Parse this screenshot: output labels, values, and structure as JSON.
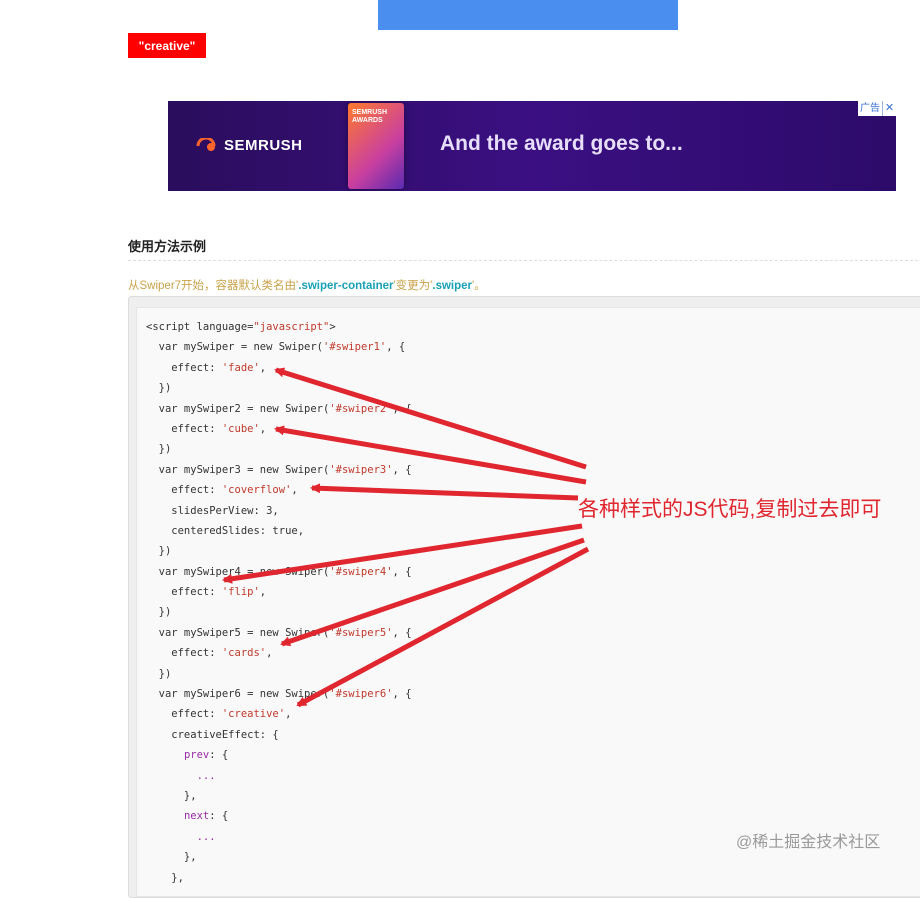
{
  "tag": {
    "label": "\"creative\""
  },
  "ad": {
    "brand": "SEMRUSH",
    "trophy_text": "SEMRUSH AWARDS",
    "headline": "And the award goes to...",
    "badge": "广告",
    "close": "✕"
  },
  "section": {
    "title": "使用方法示例"
  },
  "note": {
    "prefix": "从Swiper7开始，容器默认类名由'",
    "old_class": ".swiper-container",
    "middle": "'变更为'",
    "new_class": ".swiper",
    "suffix": "'。"
  },
  "code_lines": [
    [
      {
        "t": "<script language=",
        "c": ""
      },
      {
        "t": "\"javascript\"",
        "c": "s"
      },
      {
        "t": ">",
        "c": ""
      }
    ],
    [
      {
        "t": "  var mySwiper = new Swiper(",
        "c": ""
      },
      {
        "t": "'#swiper1'",
        "c": "s"
      },
      {
        "t": ", {",
        "c": ""
      }
    ],
    [
      {
        "t": "    effect: ",
        "c": ""
      },
      {
        "t": "'fade'",
        "c": "s"
      },
      {
        "t": ",",
        "c": ""
      }
    ],
    [
      {
        "t": "  })",
        "c": ""
      }
    ],
    [
      {
        "t": "  var mySwiper2 = new Swiper(",
        "c": ""
      },
      {
        "t": "'#swiper2'",
        "c": "s"
      },
      {
        "t": ", {",
        "c": ""
      }
    ],
    [
      {
        "t": "    effect: ",
        "c": ""
      },
      {
        "t": "'cube'",
        "c": "s"
      },
      {
        "t": ",",
        "c": ""
      }
    ],
    [
      {
        "t": "  })",
        "c": ""
      }
    ],
    [
      {
        "t": "  var mySwiper3 = new Swiper(",
        "c": ""
      },
      {
        "t": "'#swiper3'",
        "c": "s"
      },
      {
        "t": ", {",
        "c": ""
      }
    ],
    [
      {
        "t": "    effect: ",
        "c": ""
      },
      {
        "t": "'coverflow'",
        "c": "s"
      },
      {
        "t": ",",
        "c": ""
      }
    ],
    [
      {
        "t": "    slidesPerView: 3,",
        "c": ""
      }
    ],
    [
      {
        "t": "    centeredSlides: true,",
        "c": ""
      }
    ],
    [
      {
        "t": "  })",
        "c": ""
      }
    ],
    [
      {
        "t": "  var mySwiper4 = new Swiper(",
        "c": ""
      },
      {
        "t": "'#swiper4'",
        "c": "s"
      },
      {
        "t": ", {",
        "c": ""
      }
    ],
    [
      {
        "t": "    effect: ",
        "c": ""
      },
      {
        "t": "'flip'",
        "c": "s"
      },
      {
        "t": ",",
        "c": ""
      }
    ],
    [
      {
        "t": "  })",
        "c": ""
      }
    ],
    [
      {
        "t": "  var mySwiper5 = new Swiper(",
        "c": ""
      },
      {
        "t": "'#swiper5'",
        "c": "s"
      },
      {
        "t": ", {",
        "c": ""
      }
    ],
    [
      {
        "t": "    effect: ",
        "c": ""
      },
      {
        "t": "'cards'",
        "c": "s"
      },
      {
        "t": ",",
        "c": ""
      }
    ],
    [
      {
        "t": "  })",
        "c": ""
      }
    ],
    [
      {
        "t": "  var mySwiper6 = new Swiper(",
        "c": ""
      },
      {
        "t": "'#swiper6'",
        "c": "s"
      },
      {
        "t": ", {",
        "c": ""
      }
    ],
    [
      {
        "t": "    effect: ",
        "c": ""
      },
      {
        "t": "'creative'",
        "c": "s"
      },
      {
        "t": ",",
        "c": ""
      }
    ],
    [
      {
        "t": "    creativeEffect: {",
        "c": ""
      }
    ],
    [
      {
        "t": "      ",
        "c": ""
      },
      {
        "t": "prev",
        "c": "k"
      },
      {
        "t": ": {",
        "c": ""
      }
    ],
    [
      {
        "t": "        ",
        "c": ""
      },
      {
        "t": "...",
        "c": "k"
      }
    ],
    [
      {
        "t": "      },",
        "c": ""
      }
    ],
    [
      {
        "t": "      ",
        "c": ""
      },
      {
        "t": "next",
        "c": "k"
      },
      {
        "t": ": {",
        "c": ""
      }
    ],
    [
      {
        "t": "        ",
        "c": ""
      },
      {
        "t": "...",
        "c": "k"
      }
    ],
    [
      {
        "t": "      },",
        "c": ""
      }
    ],
    [
      {
        "t": "    },",
        "c": ""
      }
    ]
  ],
  "annotation": {
    "text": "各种样式的JS代码,复制过去即可"
  },
  "watermark": {
    "text": "@稀土掘金技术社区"
  },
  "colors": {
    "arrow": "#e0262f",
    "tag_bg": "#ff0000",
    "ad_bg": "#3b0f82",
    "top_bar": "#4a8ff0"
  }
}
